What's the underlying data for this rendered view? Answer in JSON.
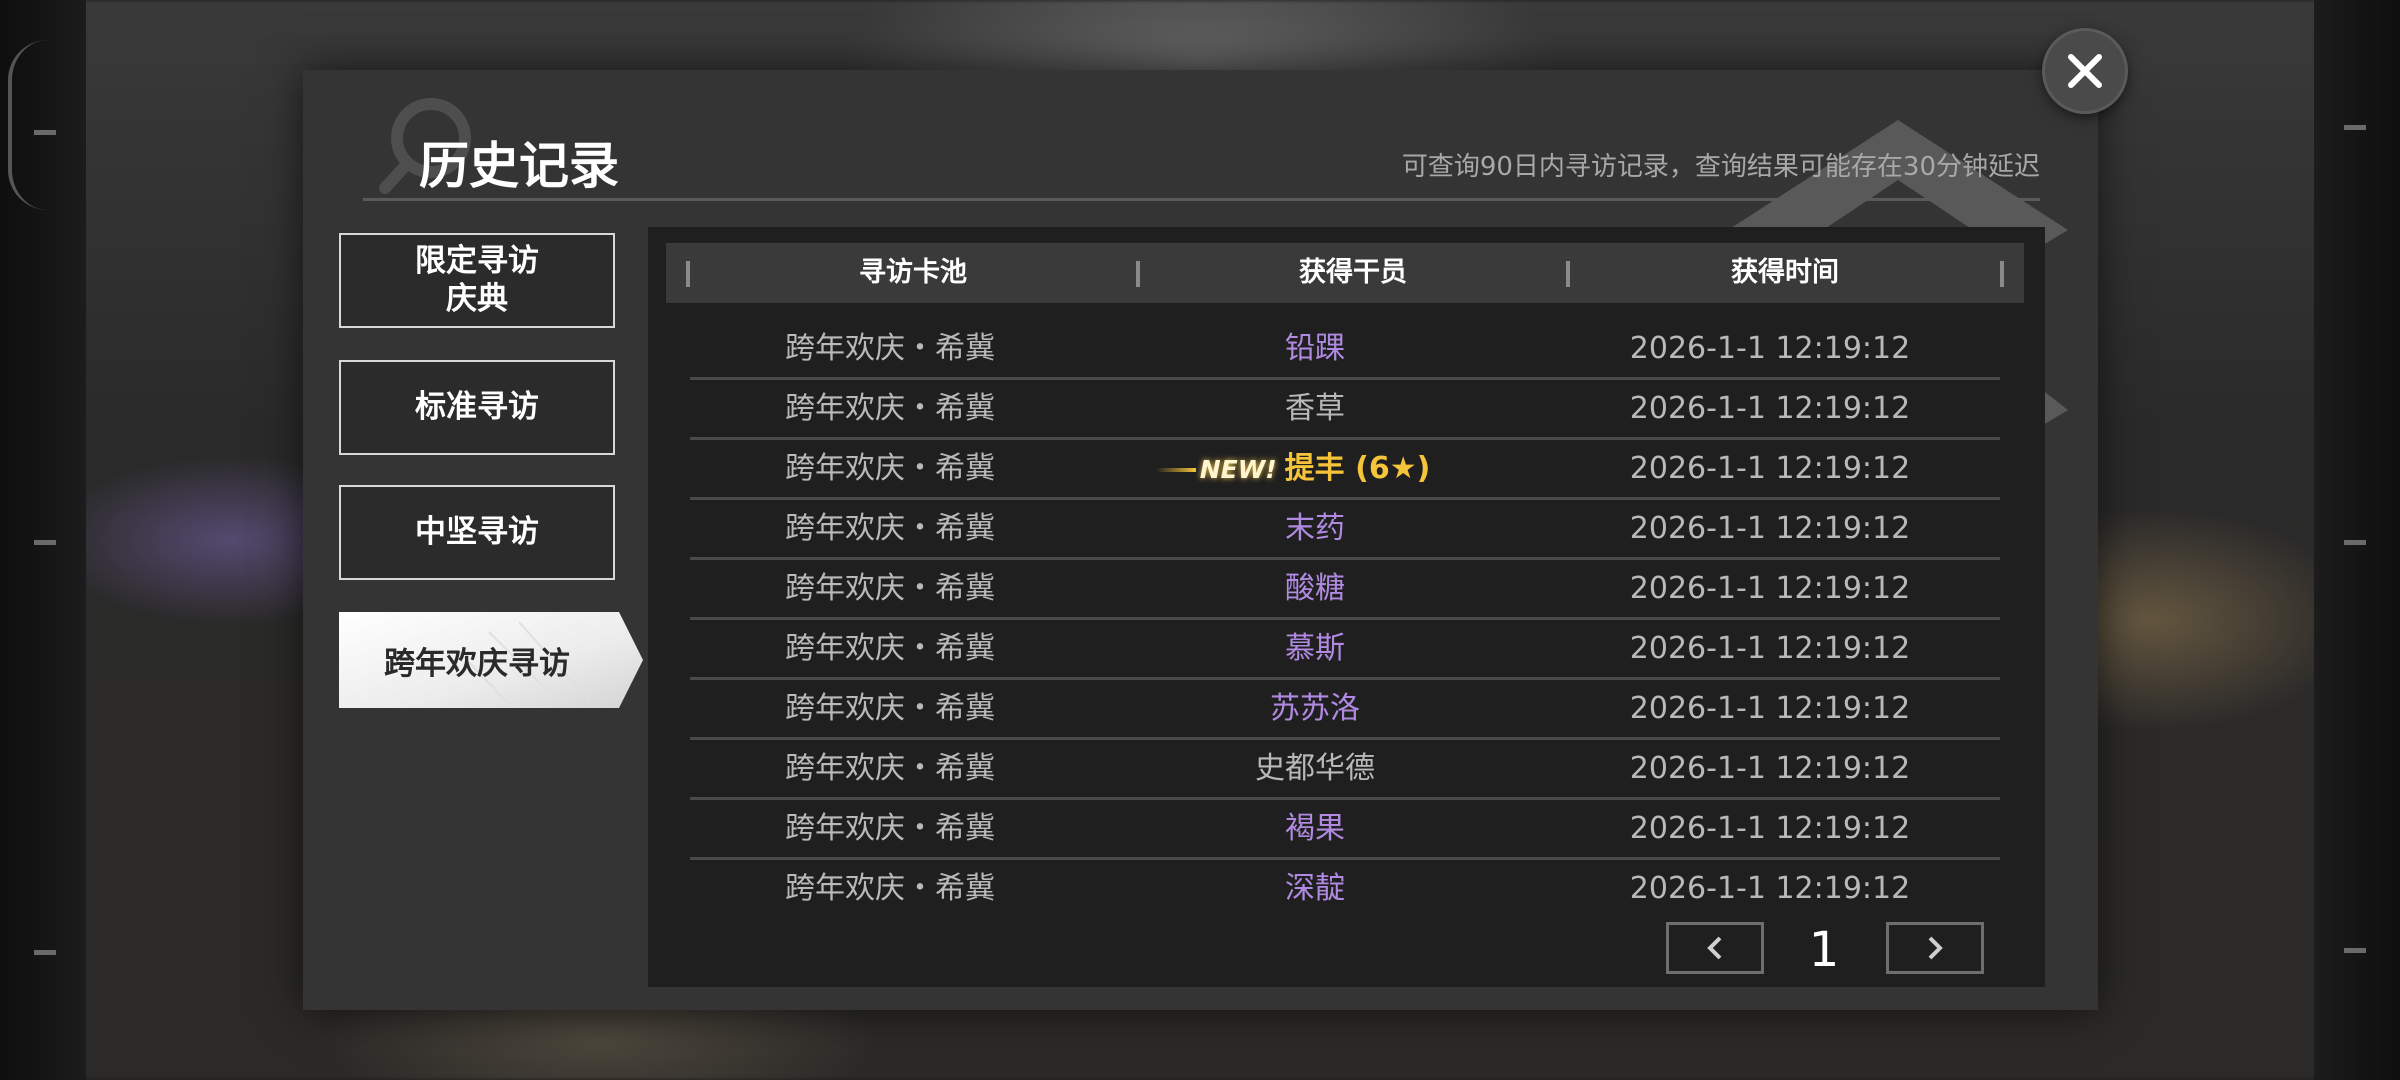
{
  "dialog": {
    "title": "历史记录",
    "subtitle": "可查询90日内寻访记录，查询结果可能存在30分钟延迟"
  },
  "tabs": [
    {
      "label": "限定寻访庆典",
      "active": false
    },
    {
      "label": "标准寻访",
      "active": false
    },
    {
      "label": "中坚寻访",
      "active": false
    },
    {
      "label": "跨年欢庆寻访",
      "active": true
    }
  ],
  "table": {
    "headers": [
      "寻访卡池",
      "获得干员",
      "获得时间"
    ],
    "rows": [
      {
        "pool": "跨年欢庆・希冀",
        "operator": "铅踝",
        "time": "2026-1-1 12:19:12",
        "color": "purple"
      },
      {
        "pool": "跨年欢庆・希冀",
        "operator": "香草",
        "time": "2026-1-1 12:19:12",
        "color": "gray"
      },
      {
        "pool": "跨年欢庆・希冀",
        "operator": "提丰 (6★)",
        "time": "2026-1-1 12:19:12",
        "color": "gold",
        "badge": "NEW!"
      },
      {
        "pool": "跨年欢庆・希冀",
        "operator": "末药",
        "time": "2026-1-1 12:19:12",
        "color": "purple"
      },
      {
        "pool": "跨年欢庆・希冀",
        "operator": "酸糖",
        "time": "2026-1-1 12:19:12",
        "color": "purple"
      },
      {
        "pool": "跨年欢庆・希冀",
        "operator": "慕斯",
        "time": "2026-1-1 12:19:12",
        "color": "purple"
      },
      {
        "pool": "跨年欢庆・希冀",
        "operator": "苏苏洛",
        "time": "2026-1-1 12:19:12",
        "color": "purple"
      },
      {
        "pool": "跨年欢庆・希冀",
        "operator": "史都华德",
        "time": "2026-1-1 12:19:12",
        "color": "gray"
      },
      {
        "pool": "跨年欢庆・希冀",
        "operator": "褐果",
        "time": "2026-1-1 12:19:12",
        "color": "purple"
      },
      {
        "pool": "跨年欢庆・希冀",
        "operator": "深靛",
        "time": "2026-1-1 12:19:12",
        "color": "purple"
      }
    ]
  },
  "pagination": {
    "current": "1"
  },
  "colors": {
    "purple": "#b08ae0",
    "gray": "#b9b9b9",
    "gold": "#f5c43a"
  },
  "icons": {
    "close": "close-icon",
    "prev": "chevron-left-icon",
    "next": "chevron-right-icon",
    "search_deco": "search-icon"
  }
}
